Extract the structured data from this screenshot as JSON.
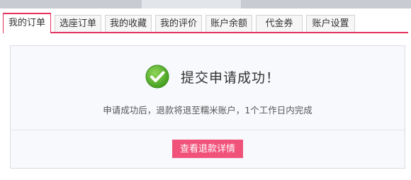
{
  "tabs": [
    {
      "label": "我的订单",
      "active": true
    },
    {
      "label": "选座订单",
      "active": false
    },
    {
      "label": "我的收藏",
      "active": false
    },
    {
      "label": "我的评价",
      "active": false
    },
    {
      "label": "账户余额",
      "active": false
    },
    {
      "label": "代金券",
      "active": false
    },
    {
      "label": "账户设置",
      "active": false
    }
  ],
  "result": {
    "icon": "check-circle-icon",
    "title": "提交申请成功！",
    "description": "申请成功后，退款将退至糯米账户，1个工作日内完成",
    "button_label": "查看退款详情"
  },
  "colors": {
    "accent": "#e5325f",
    "button": "#f0527a",
    "success": "#5cb531"
  }
}
